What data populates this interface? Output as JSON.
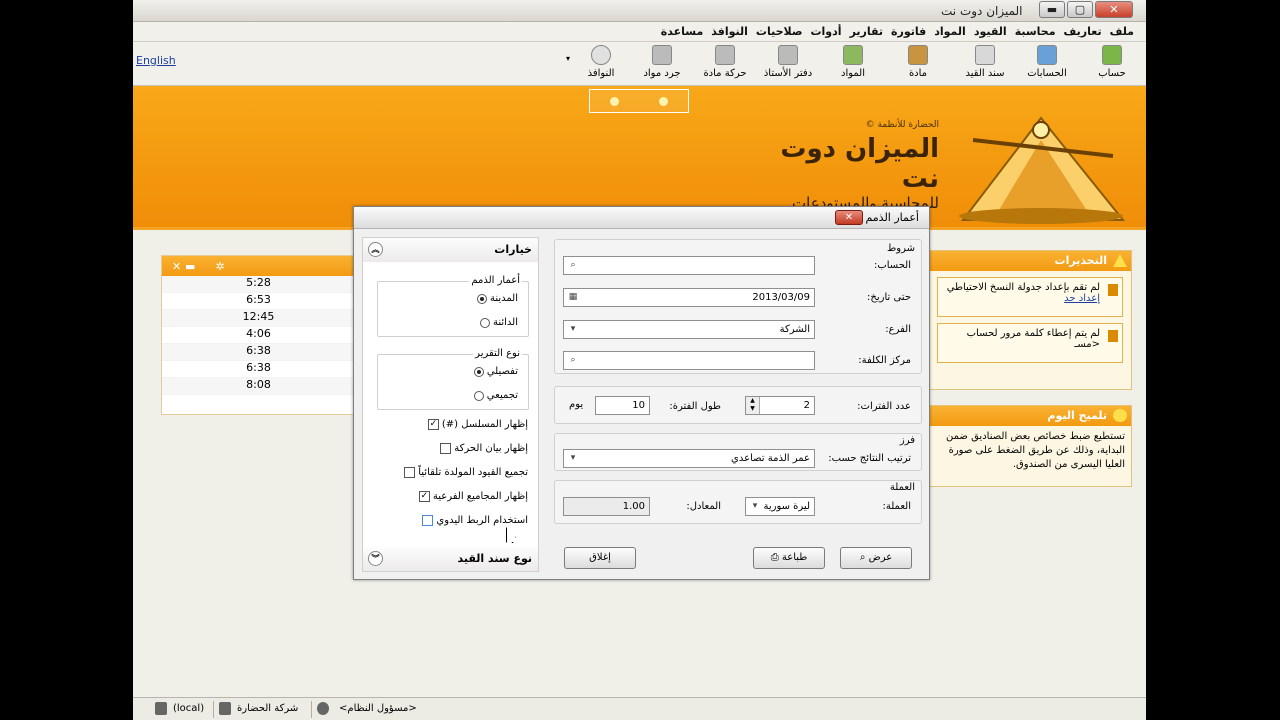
{
  "window": {
    "title": "الميزان دوت نت",
    "minimize": "▬",
    "maximize": "▢",
    "close": "✕"
  },
  "menus": [
    "ملف",
    "تعاريف",
    "محاسبة",
    "القيود",
    "المواد",
    "فاتورة",
    "تقارير",
    "أدوات",
    "صلاحيات",
    "النوافذ",
    "مساعدة"
  ],
  "toolbar": {
    "english": "English",
    "items": [
      {
        "label": "حساب",
        "icon": "account-icon",
        "color": "#7ab648"
      },
      {
        "label": "الحسابات",
        "icon": "accounts-icon",
        "color": "#6aa0d8"
      },
      {
        "label": "سند القيد",
        "icon": "journal-voucher-icon",
        "color": "#d8d8d8"
      },
      {
        "label": "مادة",
        "icon": "item-box-icon",
        "color": "#c89440"
      },
      {
        "label": "المواد",
        "icon": "items-icon",
        "color": "#8cb860"
      },
      {
        "label": "دفتر الأستاذ",
        "icon": "ledger-print-icon",
        "color": "#bbbbbb"
      },
      {
        "label": "حركة مادة",
        "icon": "item-movement-print-icon",
        "color": "#bbbbbb"
      },
      {
        "label": "جرد مواد",
        "icon": "inventory-print-icon",
        "color": "#bbbbbb"
      },
      {
        "label": "النوافذ",
        "icon": "clock-windows-icon",
        "color": "#e0e0e0"
      }
    ],
    "dropdown": "▾"
  },
  "banner": {
    "company": "الحضارة للأنظمة ©",
    "product": "الميزان دوت نت",
    "subtitle": "للمحاسبة والمستودعات",
    "accent": "#f39a12"
  },
  "clock_panel": {
    "times": [
      "5:28",
      "6:53",
      "12:45",
      "4:06",
      "6:38",
      "6:38",
      "8:08"
    ],
    "controls": "✕ ▬",
    "gear": "✲"
  },
  "alerts": {
    "title": "التحذيرات",
    "items": [
      {
        "text": "لم تقم بإعداد جدولة النسخ الاحتياطي",
        "link": "إعداد جد"
      },
      {
        "text": "لم يتم إعطاء كلمة مرور لحساب <مسـ",
        "link": ""
      }
    ]
  },
  "tip": {
    "title": "تلميح اليوم",
    "text": "تستطيع ضبط خصائص بعض الصناديق ضمن البداية، وذلك عن طريق الضغط على صورة العليا اليسرى من الصندوق."
  },
  "status": {
    "user": "<مسؤول النظام>",
    "company": "شركة الحضارة",
    "server": "(local)"
  },
  "dialog": {
    "title": "أعمار الذمم",
    "close": "✕",
    "options": {
      "header": "خيارات",
      "footer": "نوع سند القيد",
      "collapse": "︽",
      "expand": "︾",
      "debt_group": {
        "legend": "أعمار الذمم",
        "options": [
          "المدينة",
          "الدائنة"
        ],
        "selected": "المدينة"
      },
      "report_group": {
        "legend": "نوع التقرير",
        "options": [
          "تفصيلي",
          "تجميعي"
        ],
        "selected": "تفصيلي"
      },
      "checkboxes": [
        {
          "label": "إظهار المسلسل (#)",
          "checked": true
        },
        {
          "label": "إظهار بيان الحركة",
          "checked": false
        },
        {
          "label": "تجميع القيود المولدة تلقائياً",
          "checked": false
        },
        {
          "label": "إظهار المجاميع الفرعية",
          "checked": true
        },
        {
          "label": "استخدام الربط اليدوي",
          "checked": false
        }
      ]
    },
    "conditions": {
      "title": "شروط",
      "account_label": "الحساب:",
      "account_value": "",
      "to_date_label": "حتى تاريخ:",
      "to_date_value": "2013/03/09",
      "branch_label": "الفرع:",
      "branch_value": "الشركة",
      "cost_center_label": "مركز الكلفة:",
      "cost_center_value": ""
    },
    "periods": {
      "count_label": "عدد الفترات:",
      "count_value": "2",
      "length_label": "طول الفترة:",
      "length_value": "10",
      "unit": "يوم"
    },
    "sort": {
      "title": "فرز",
      "label": "ترتيب النتائج حسب:",
      "value": "عمر الذمة تصاعدي"
    },
    "currency": {
      "title": "العملة",
      "label": "العملة:",
      "value": "ليرة سورية",
      "rate_label": "المعادل:",
      "rate_value": "1.00"
    },
    "buttons": {
      "show": "عرض",
      "print": "طباعة",
      "close": "إغلاق"
    }
  }
}
